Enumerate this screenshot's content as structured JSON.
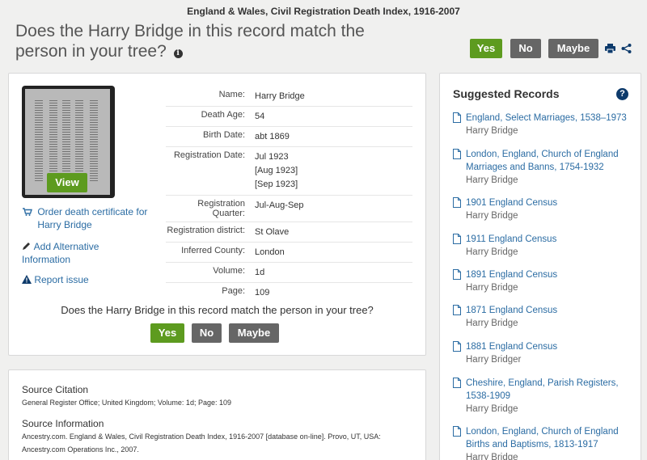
{
  "header": {
    "collection": "England & Wales, Civil Registration Death Index, 1916-2007",
    "question": "Does the Harry Bridge in this record match the person in your tree?",
    "info_icon": "i"
  },
  "actions": {
    "yes": "Yes",
    "no": "No",
    "maybe": "Maybe"
  },
  "record": {
    "view_label": "View",
    "order_link": "Order death certificate for Harry Bridge",
    "add_alt_link": "Add Alternative Information",
    "report_link": "Report issue",
    "fields": [
      {
        "label": "Name:",
        "values": [
          "Harry Bridge"
        ]
      },
      {
        "label": "Death Age:",
        "values": [
          "54"
        ]
      },
      {
        "label": "Birth Date:",
        "values": [
          "abt 1869"
        ]
      },
      {
        "label": "Registration Date:",
        "values": [
          "Jul 1923",
          "[Aug 1923]",
          "[Sep 1923]"
        ]
      },
      {
        "label": "Registration Quarter:",
        "values": [
          "Jul-Aug-Sep"
        ]
      },
      {
        "label": "Registration district:",
        "values": [
          "St Olave"
        ]
      },
      {
        "label": "Inferred County:",
        "values": [
          "London"
        ]
      },
      {
        "label": "Volume:",
        "values": [
          "1d"
        ]
      },
      {
        "label": "Page:",
        "values": [
          "109"
        ]
      }
    ],
    "bottom_question": "Does the Harry Bridge in this record match the person in your tree?"
  },
  "source": {
    "citation_heading": "Source Citation",
    "citation_text": "General Register Office; United Kingdom; Volume: 1d; Page: 109",
    "info_heading": "Source Information",
    "info_text": "Ancestry.com. England & Wales, Civil Registration Death Index, 1916-2007 [database on-line]. Provo, UT, USA: Ancestry.com Operations Inc., 2007."
  },
  "suggested": {
    "title": "Suggested Records",
    "help": "?",
    "items": [
      {
        "title": "England, Select Marriages, 1538–1973",
        "name": "Harry Bridge"
      },
      {
        "title": "London, England, Church of England Marriages and Banns, 1754-1932",
        "name": "Harry Bridge"
      },
      {
        "title": "1901 England Census",
        "name": "Harry Bridge"
      },
      {
        "title": "1911 England Census",
        "name": "Harry Bridge"
      },
      {
        "title": "1891 England Census",
        "name": "Harry Bridge"
      },
      {
        "title": "1871 England Census",
        "name": "Harry Bridge"
      },
      {
        "title": "1881 England Census",
        "name": "Harry Bridger"
      },
      {
        "title": "Cheshire, England, Parish Registers, 1538-1909",
        "name": "Harry Bridge"
      },
      {
        "title": "London, England, Church of England Births and Baptisms, 1813-1917",
        "name": "Harry Bridge"
      }
    ]
  },
  "colors": {
    "accent_green": "#5d9b1f",
    "grey_button": "#666666",
    "link_blue": "#2b6ca3"
  }
}
